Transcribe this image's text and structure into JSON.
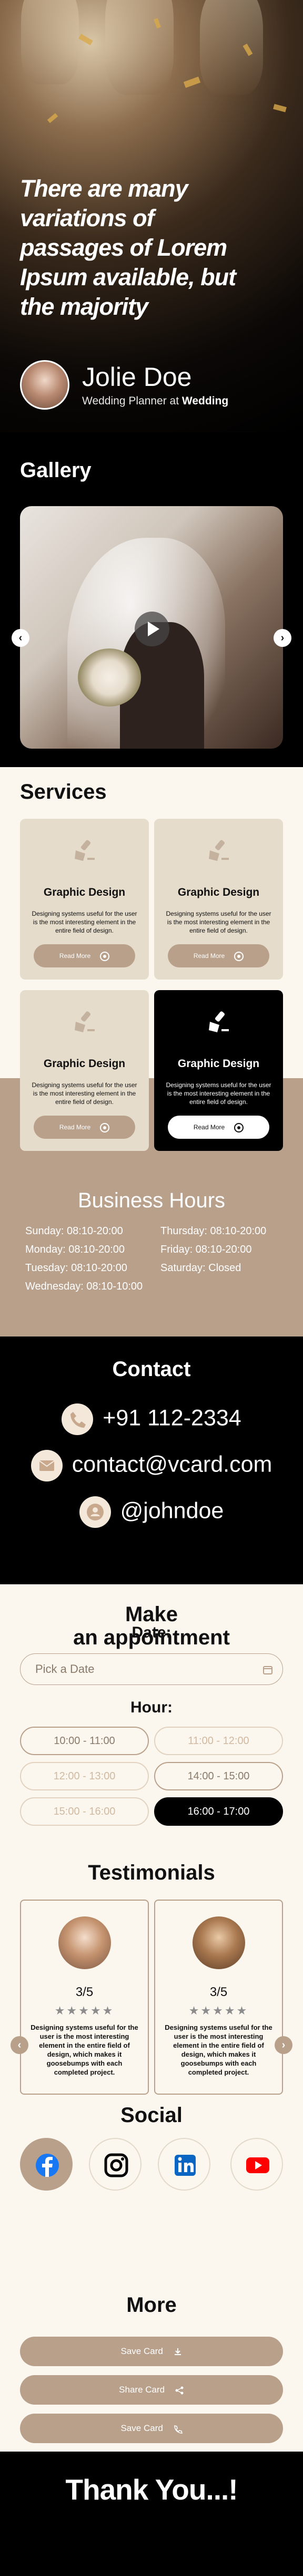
{
  "hero": {
    "quote": "There are many variations of passages of Lorem Ipsum available, but the majority",
    "name": "Jolie Doe",
    "role_prefix": "Wedding Planner at",
    "role_company": "Wedding"
  },
  "gallery": {
    "title": "Gallery",
    "prev": "‹",
    "next": "›"
  },
  "services": {
    "title": "Services",
    "items": [
      {
        "title": "Graphic Design",
        "desc": "Designing systems useful for the user is the most interesting element in the entire field of design.",
        "button": "Read More"
      },
      {
        "title": "Graphic Design",
        "desc": "Designing systems useful for the user is the most interesting element in the entire field of design.",
        "button": "Read More"
      },
      {
        "title": "Graphic Design",
        "desc": "Designing systems useful for the user is the most interesting element in the entire field of design.",
        "button": "Read More"
      },
      {
        "title": "Graphic Design",
        "desc": "Designing systems useful for the user is the most interesting element in the entire field of design.",
        "button": "Read More"
      }
    ]
  },
  "hours": {
    "title": "Business Hours",
    "left": [
      "Sunday: 08:10-20:00",
      "Monday: 08:10-20:00",
      "Tuesday: 08:10-20:00",
      "Wednesday: 08:10-10:00"
    ],
    "right": [
      "Thursday: 08:10-20:00",
      "Friday: 08:10-20:00",
      "Saturday: Closed"
    ]
  },
  "contact": {
    "title": "Contact",
    "phone": "+91 112-2334",
    "email": "contact@vcard.com",
    "handle": "@johndoe"
  },
  "appointment": {
    "title_line1": "Make",
    "title_line2": "an appointment",
    "date_label": "Date:",
    "date_placeholder": "Pick a Date",
    "hour_label": "Hour:",
    "slots": [
      "10:00 - 11:00",
      "11:00 - 12:00",
      "12:00 - 13:00",
      "14:00 - 15:00",
      "15:00 - 16:00",
      "16:00 - 17:00"
    ]
  },
  "testimonials": {
    "title": "Testimonials",
    "items": [
      {
        "rating": "3/5",
        "stars": "★★★★★",
        "text": "Designing systems useful for the user is the most interesting element in the entire field of design, which makes it goosebumps with each completed project."
      },
      {
        "rating": "3/5",
        "stars": "★★★★★",
        "text": "Designing systems useful for the user is the most interesting element in the entire field of design, which makes it goosebumps with each completed project."
      }
    ]
  },
  "social": {
    "title": "Social",
    "icons": [
      "facebook-icon",
      "instagram-icon",
      "linkedin-icon",
      "youtube-icon"
    ]
  },
  "more": {
    "title": "More",
    "buttons": [
      "Save Card",
      "Share Card",
      "Save Card"
    ]
  },
  "footer": {
    "thanks": "Thank You...!"
  },
  "colors": {
    "accent": "#b9a08b",
    "cream": "#fbf7ee",
    "card": "#e6dccb",
    "dark": "#000000"
  }
}
